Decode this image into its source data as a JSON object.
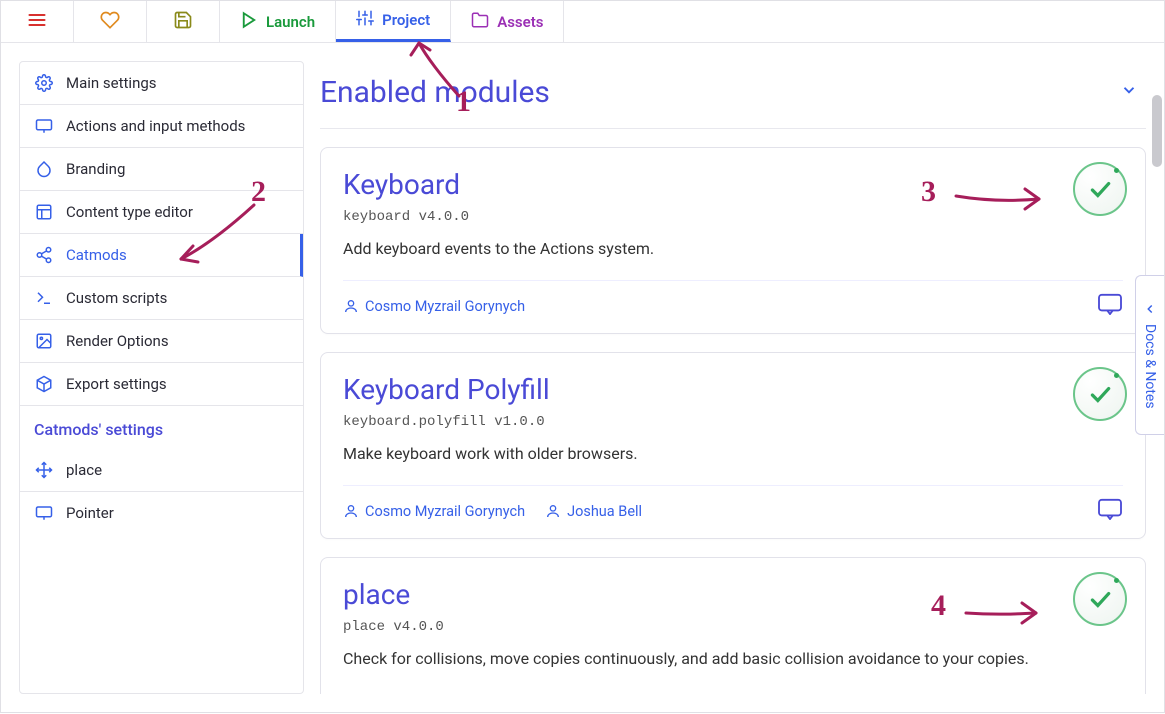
{
  "topbar": {
    "launch": "Launch",
    "project": "Project",
    "assets": "Assets"
  },
  "sidebar": {
    "items": [
      {
        "label": "Main settings"
      },
      {
        "label": "Actions and input methods"
      },
      {
        "label": "Branding"
      },
      {
        "label": "Content type editor"
      },
      {
        "label": "Catmods"
      },
      {
        "label": "Custom scripts"
      },
      {
        "label": "Render Options"
      },
      {
        "label": "Export settings"
      }
    ],
    "section_title": "Catmods' settings",
    "settings_items": [
      {
        "label": "place"
      },
      {
        "label": "Pointer"
      }
    ]
  },
  "content": {
    "heading": "Enabled modules",
    "modules": [
      {
        "title": "Keyboard",
        "version": "keyboard v4.0.0",
        "desc": "Add keyboard events to the Actions system.",
        "authors": [
          "Cosmo Myzrail Gorynych"
        ]
      },
      {
        "title": "Keyboard Polyfill",
        "version": "keyboard.polyfill v1.0.0",
        "desc": "Make keyboard work with older browsers.",
        "authors": [
          "Cosmo Myzrail Gorynych",
          "Joshua Bell"
        ]
      },
      {
        "title": "place",
        "version": "place v4.0.0",
        "desc": "Check for collisions, move copies continuously, and add basic collision avoidance to your copies.",
        "authors": []
      }
    ]
  },
  "docs_tab": "Docs & Notes",
  "annotations": [
    "1",
    "2",
    "3",
    "4"
  ]
}
